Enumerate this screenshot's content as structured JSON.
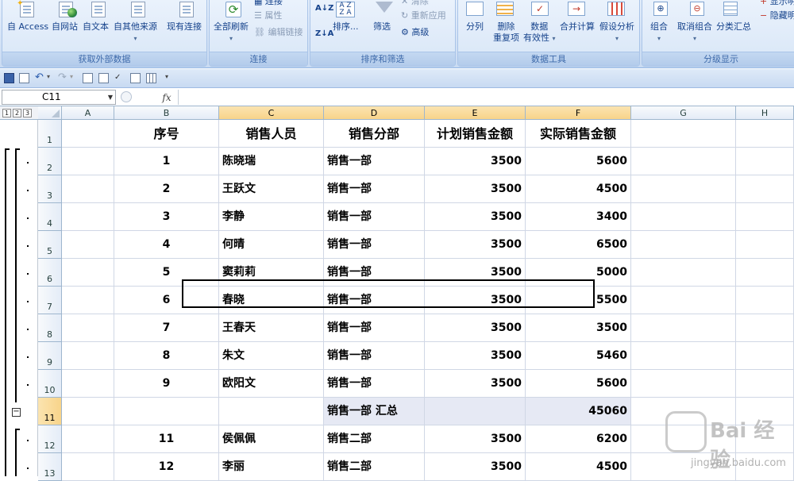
{
  "ribbon": {
    "groups": {
      "external_data": {
        "label": "获取外部数据",
        "access": "自 Access",
        "web": "自网站",
        "text": "自文本",
        "other": "自其他来源",
        "existing": "现有连接"
      },
      "connections": {
        "label": "连接",
        "refresh_all": "全部刷新",
        "connections": "连接",
        "properties": "属性",
        "edit_links": "编辑链接"
      },
      "sort_filter": {
        "label": "排序和筛选",
        "sort": "排序...",
        "filter": "筛选",
        "clear": "清除",
        "reapply": "重新应用",
        "advanced": "高级"
      },
      "data_tools": {
        "label": "数据工具",
        "text_to_columns": "分列",
        "remove_dup_line1": "删除",
        "remove_dup_line2": "重复项",
        "validation_line1": "数据",
        "validation_line2": "有效性",
        "consolidate": "合并计算",
        "what_if": "假设分析"
      },
      "outline": {
        "label": "分级显示",
        "group": "组合",
        "ungroup": "取消组合",
        "subtotal": "分类汇总",
        "show_detail": "显示明",
        "hide_detail": "隐藏明"
      }
    }
  },
  "formula_bar": {
    "name_box": "C11",
    "fx": "fx",
    "content": ""
  },
  "outline_levels": [
    "1",
    "2",
    "3"
  ],
  "columns": [
    {
      "letter": "A",
      "selected": false
    },
    {
      "letter": "B",
      "selected": false
    },
    {
      "letter": "C",
      "selected": true
    },
    {
      "letter": "D",
      "selected": true
    },
    {
      "letter": "E",
      "selected": true
    },
    {
      "letter": "F",
      "selected": true
    },
    {
      "letter": "G",
      "selected": false
    },
    {
      "letter": "H",
      "selected": false
    }
  ],
  "headers": {
    "b": "序号",
    "c": "销售人员",
    "d": "销售分部",
    "e": "计划销售金额",
    "f": "实际销售金额"
  },
  "rows": [
    {
      "num": "2",
      "b": "1",
      "c": "陈晓瑞",
      "d": "销售一部",
      "e": "3500",
      "f": "5600"
    },
    {
      "num": "3",
      "b": "2",
      "c": "王跃文",
      "d": "销售一部",
      "e": "3500",
      "f": "4500"
    },
    {
      "num": "4",
      "b": "3",
      "c": "李静",
      "d": "销售一部",
      "e": "3500",
      "f": "3400"
    },
    {
      "num": "5",
      "b": "4",
      "c": "何晴",
      "d": "销售一部",
      "e": "3500",
      "f": "6500"
    },
    {
      "num": "6",
      "b": "5",
      "c": "窦莉莉",
      "d": "销售一部",
      "e": "3500",
      "f": "5000"
    },
    {
      "num": "7",
      "b": "6",
      "c": "春晓",
      "d": "销售一部",
      "e": "3500",
      "f": "5500"
    },
    {
      "num": "8",
      "b": "7",
      "c": "王春天",
      "d": "销售一部",
      "e": "3500",
      "f": "3500"
    },
    {
      "num": "9",
      "b": "8",
      "c": "朱文",
      "d": "销售一部",
      "e": "3500",
      "f": "5460"
    },
    {
      "num": "10",
      "b": "9",
      "c": "欧阳文",
      "d": "销售一部",
      "e": "3500",
      "f": "5600"
    }
  ],
  "subtotal_row": {
    "num": "11",
    "d": "销售一部 汇总",
    "f": "45060"
  },
  "rows_after": [
    {
      "num": "12",
      "b": "11",
      "c": "侯佩佩",
      "d": "销售二部",
      "e": "3500",
      "f": "6200"
    },
    {
      "num": "13",
      "b": "12",
      "c": "李丽",
      "d": "销售二部",
      "e": "3500",
      "f": "4500"
    }
  ],
  "header_row_num": "1",
  "watermark": {
    "text": "Bai 经验",
    "url": "jingyan.baidu.com"
  }
}
